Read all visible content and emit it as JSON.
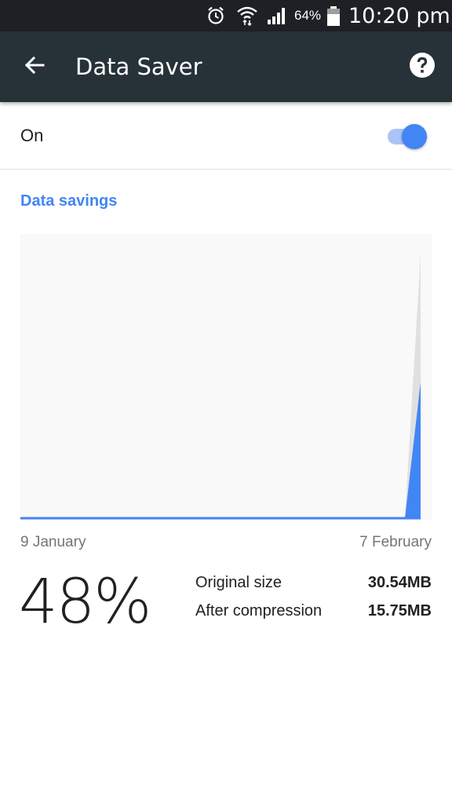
{
  "status_bar": {
    "battery_pct": "64%",
    "time": "10:20 pm",
    "icons": [
      "alarm-icon",
      "wifi-icon",
      "signal-icon",
      "battery-icon"
    ]
  },
  "app_bar": {
    "title": "Data Saver",
    "back_icon": "arrow-left-icon",
    "help_icon": "help-circle-icon"
  },
  "toggle": {
    "label": "On",
    "state": "on"
  },
  "section": {
    "title": "Data savings"
  },
  "chart_data": {
    "type": "area",
    "x_start_label": "9 January",
    "x_end_label": "7 February",
    "x": [
      "9 January",
      "7 February"
    ],
    "series": [
      {
        "values": [
          0,
          0,
          30.54
        ],
        "color": "#e0e0e0"
      },
      {
        "values": [
          0,
          0,
          15.75
        ],
        "color": "#4285f4"
      }
    ],
    "ylim": [
      0,
      32
    ],
    "grid": false
  },
  "summary": {
    "percent": "48%",
    "original_label": "Original size",
    "original_value": "30.54MB",
    "compressed_label": "After compression",
    "compressed_value": "15.75MB"
  },
  "colors": {
    "accent": "#4285f4",
    "app_bar": "#263238",
    "status_bar": "#1d2126"
  }
}
